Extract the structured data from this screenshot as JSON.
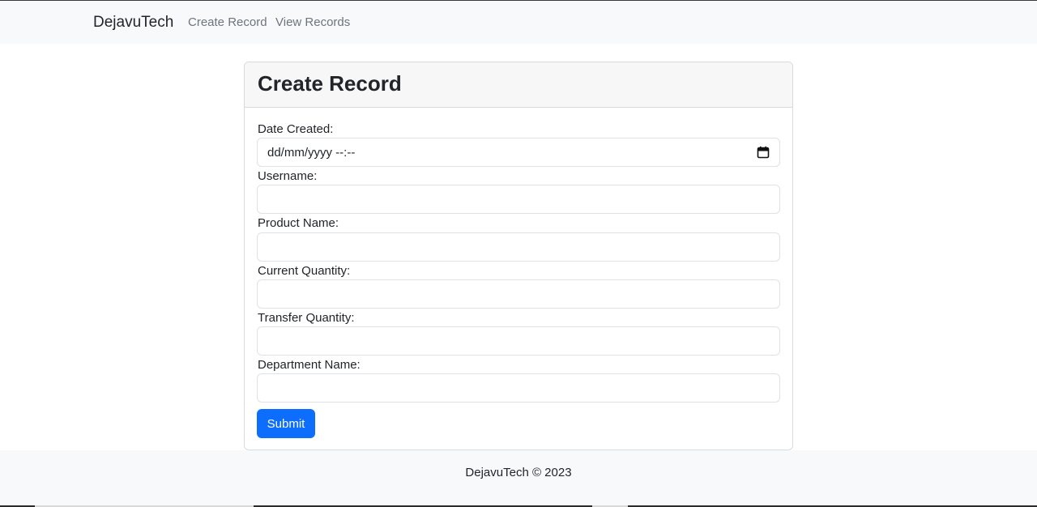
{
  "navbar": {
    "brand": "DejavuTech",
    "links": [
      "Create Record",
      "View Records"
    ]
  },
  "form": {
    "title": "Create Record",
    "fields": [
      {
        "label": "Date Created:",
        "value": "dd/mm/yyyy --:--",
        "type": "datetime-local"
      },
      {
        "label": "Username:",
        "value": ""
      },
      {
        "label": "Product Name:",
        "value": ""
      },
      {
        "label": "Current Quantity:",
        "value": ""
      },
      {
        "label": "Transfer Quantity:",
        "value": ""
      },
      {
        "label": "Department Name:",
        "value": ""
      }
    ],
    "submit_label": "Submit"
  },
  "footer": {
    "text": "DejavuTech © 2023"
  },
  "colors": {
    "primary": "#0d6efd",
    "navbar_bg": "#f8f9fa",
    "card_header_bg": "#f7f7f7"
  },
  "icons": {
    "date_picker": "calendar-icon"
  }
}
